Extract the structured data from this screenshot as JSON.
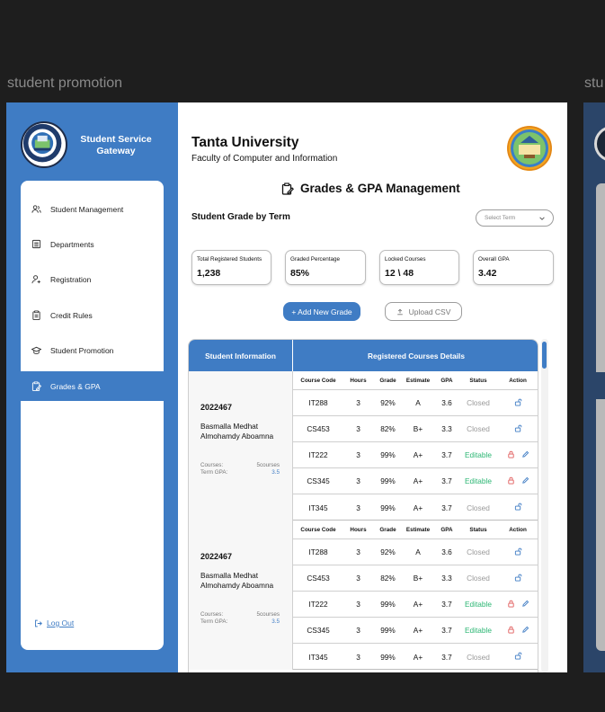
{
  "frame": {
    "label": "student promotion",
    "label_next": "stu"
  },
  "sidebar": {
    "brand": "Student Service Gateway",
    "items": [
      {
        "label": "Student Management",
        "icon": "users-icon"
      },
      {
        "label": "Departments",
        "icon": "list-icon"
      },
      {
        "label": "Registration",
        "icon": "user-plus-icon"
      },
      {
        "label": "Credit Rules",
        "icon": "clipboard-icon"
      },
      {
        "label": "Student Promotion",
        "icon": "graduation-cap-icon"
      },
      {
        "label": "Grades & GPA",
        "icon": "edit-note-icon",
        "active": true
      }
    ],
    "logout": "Log Out"
  },
  "header": {
    "university": "Tanta University",
    "faculty": "Faculty of Computer and Information",
    "page_title": "Grades & GPA Management"
  },
  "filter": {
    "section_title": "Student Grade by Term",
    "term_placeholder": "Select Term"
  },
  "stats": [
    {
      "label": "Total Registered Students",
      "value": "1,238"
    },
    {
      "label": "Graded Percentage",
      "value": "85%"
    },
    {
      "label": "Locked Courses",
      "value": "12 \\ 48"
    },
    {
      "label": "Overall GPA",
      "value": "3.42"
    }
  ],
  "actions": {
    "add": "+ Add New Grade",
    "upload": "Upload CSV"
  },
  "table": {
    "col_student": "Student Information",
    "col_courses": "Registered Courses Details",
    "course_headers": [
      "Course Code",
      "Hours",
      "Grade",
      "Estimate",
      "GPA",
      "Status",
      "Action"
    ],
    "courses_label": "Courses:",
    "gpa_label": "Term GPA:",
    "students": [
      {
        "id": "2022467",
        "name": "Basmalla Medhat Almohamdy Aboamna",
        "courses_count": "5courses",
        "term_gpa": "3.5",
        "rows": [
          {
            "code": "IT288",
            "hours": "3",
            "grade": "92%",
            "estimate": "A",
            "gpa": "3.6",
            "status": "Closed"
          },
          {
            "code": "CS453",
            "hours": "3",
            "grade": "82%",
            "estimate": "B+",
            "gpa": "3.3",
            "status": "Closed"
          },
          {
            "code": "IT222",
            "hours": "3",
            "grade": "99%",
            "estimate": "A+",
            "gpa": "3.7",
            "status": "Editable"
          },
          {
            "code": "CS345",
            "hours": "3",
            "grade": "99%",
            "estimate": "A+",
            "gpa": "3.7",
            "status": "Editable"
          },
          {
            "code": "IT345",
            "hours": "3",
            "grade": "99%",
            "estimate": "A+",
            "gpa": "3.7",
            "status": "Closed"
          }
        ]
      },
      {
        "id": "2022467",
        "name": "Basmalla Medhat Almohamdy Aboamna",
        "courses_count": "5courses",
        "term_gpa": "3.5",
        "rows": [
          {
            "code": "IT288",
            "hours": "3",
            "grade": "92%",
            "estimate": "A",
            "gpa": "3.6",
            "status": "Closed"
          },
          {
            "code": "CS453",
            "hours": "3",
            "grade": "82%",
            "estimate": "B+",
            "gpa": "3.3",
            "status": "Closed"
          },
          {
            "code": "IT222",
            "hours": "3",
            "grade": "99%",
            "estimate": "A+",
            "gpa": "3.7",
            "status": "Editable"
          },
          {
            "code": "CS345",
            "hours": "3",
            "grade": "99%",
            "estimate": "A+",
            "gpa": "3.7",
            "status": "Editable"
          },
          {
            "code": "IT345",
            "hours": "3",
            "grade": "99%",
            "estimate": "A+",
            "gpa": "3.7",
            "status": "Closed"
          }
        ]
      }
    ]
  },
  "colors": {
    "primary": "#3f7cc4",
    "editable": "#2bb673",
    "locked": "#e05a5a",
    "closed": "#9a9a9a"
  }
}
